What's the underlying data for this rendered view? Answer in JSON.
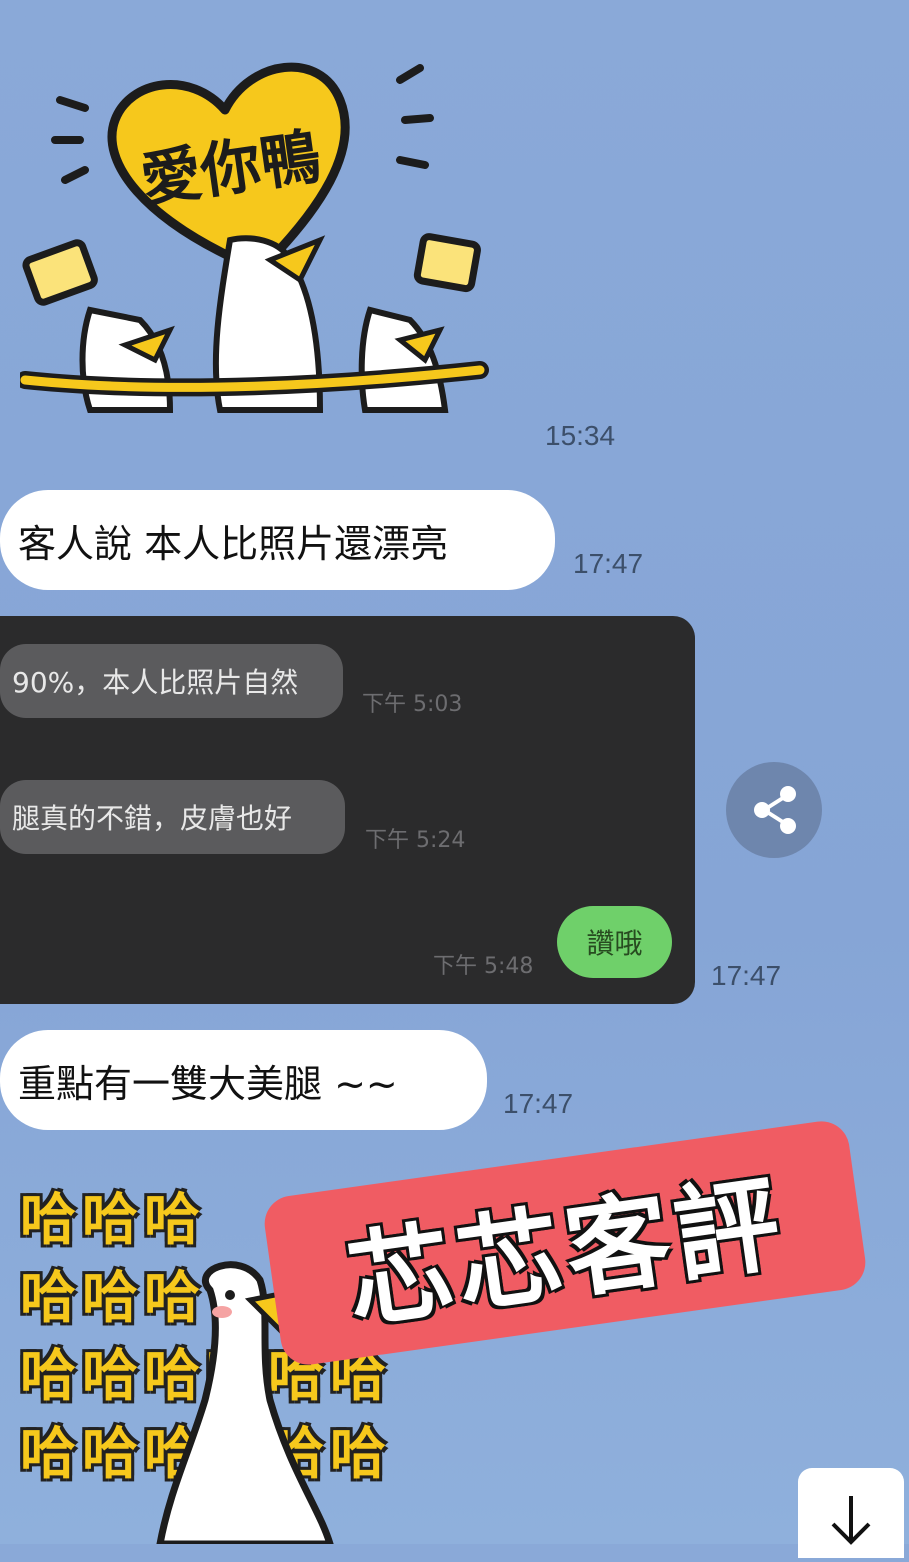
{
  "sticker_top": {
    "heart_text": "愛你鴨",
    "time": "15:34"
  },
  "messages": [
    {
      "text": "客人說 本人比照片還漂亮",
      "time": "17:47"
    },
    {
      "text": "重點有一雙大美腿 ~~",
      "time": "17:47"
    }
  ],
  "screenshot_card": {
    "time": "17:47",
    "inner": [
      {
        "text": "90%，本人比照片自然",
        "time": "下午 5:03"
      },
      {
        "text": "腿真的不錯，皮膚也好",
        "time": "下午 5:24"
      }
    ],
    "reply": {
      "text": "讚哦",
      "time": "下午 5:48"
    }
  },
  "sticker_bottom": {
    "ha": "哈",
    "banner": "芯芯客評"
  },
  "icons": {
    "share": "share-icon",
    "scroll_down": "arrow-down-icon"
  },
  "colors": {
    "chat_bg": "#8aa9d8",
    "banner": "#f05c63",
    "reply_green": "#6fd06a",
    "heart_yellow": "#f6c81c"
  }
}
